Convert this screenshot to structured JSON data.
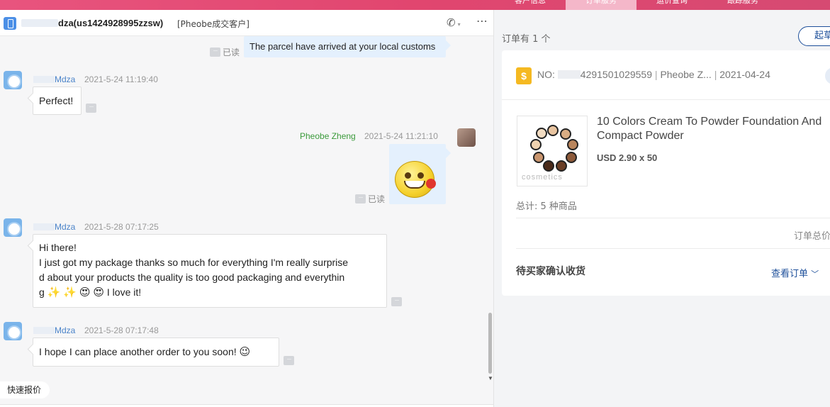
{
  "top_tabs": [
    {
      "label": "客户信息"
    },
    {
      "label": "订单服务",
      "active": true
    },
    {
      "label": "运价查询"
    },
    {
      "label": "跟踪服务"
    }
  ],
  "chat": {
    "header": {
      "contact_name": "dza(us1424928995zzsw)",
      "tag": "[Pheobe成交客户]"
    },
    "messages": [
      {
        "direction": "out",
        "text": "The parcel have arrived at your local customs",
        "read_label": "已读"
      },
      {
        "direction": "in",
        "sender": "Mdza",
        "time": "2021-5-24 11:19:40",
        "text": "Perfect!"
      },
      {
        "direction": "out",
        "sender": "Pheobe Zheng",
        "time": "2021-5-24 11:21:10",
        "content": "emoji-sticker-rose-smile",
        "read_label": "已读"
      },
      {
        "direction": "in",
        "sender": "Mdza",
        "time": "2021-5-28 07:17:25",
        "lines": [
          "Hi there!",
          "I just got my package thanks so much for everything I'm really surprise",
          "d about your products the quality is too good packaging and everythin",
          "g"
        ],
        "tail_text": "I love it!",
        "emojis": [
          "sparkles",
          "sparkles",
          "heart-eyes",
          "heart-eyes"
        ]
      },
      {
        "direction": "in",
        "sender": "Mdza",
        "time": "2021-5-28 07:17:48",
        "text": "I hope I can place another order to you soon!",
        "emoji": "wink"
      }
    ],
    "quick_quote_label": "快速报价"
  },
  "orders": {
    "count_label": "订单有 1 个",
    "action_label": "起草",
    "order": {
      "no_label": "NO:",
      "no_value": "4291501029559",
      "seller": "Pheobe Z...",
      "date": "2021-04-24",
      "product_title_line1": "10 Colors Cream To Powder Foundation And",
      "product_title_line2": "Compact Powder",
      "price": "USD 2.90 x 50",
      "total_items": "总计: 5 种商品",
      "order_total_label": "订单总价",
      "status": "待买家确认收货",
      "view_order_label": "查看订单"
    }
  },
  "colors": {
    "brand_pink": "#e1466f",
    "link_blue": "#1d4f9a",
    "sender_blue": "#4a83c9",
    "self_green": "#3b9a3b",
    "out_bubble": "#e4f0fd"
  }
}
